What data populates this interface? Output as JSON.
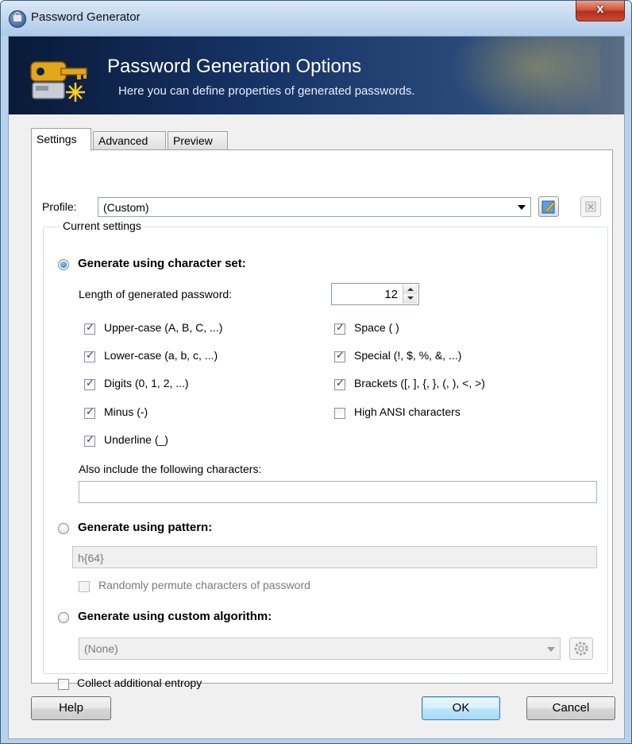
{
  "window": {
    "title": "Password Generator",
    "close_label": "x"
  },
  "banner": {
    "title": "Password Generation Options",
    "subtitle": "Here you can define properties of generated passwords."
  },
  "tabs": [
    {
      "label": "Settings",
      "active": true
    },
    {
      "label": "Advanced",
      "active": false
    },
    {
      "label": "Preview",
      "active": false
    }
  ],
  "profile": {
    "label": "Profile:",
    "value": "(Custom)"
  },
  "group": {
    "legend": "Current settings"
  },
  "charset": {
    "radio_label": "Generate using character set:",
    "selected": true,
    "length_label": "Length of generated password:",
    "length_value": "12",
    "options_left": [
      {
        "label": "Upper-case (A, B, C, ...)",
        "checked": true
      },
      {
        "label": "Lower-case (a, b, c, ...)",
        "checked": true
      },
      {
        "label": "Digits (0, 1, 2, ...)",
        "checked": true
      },
      {
        "label": "Minus (-)",
        "checked": true
      },
      {
        "label": "Underline (_)",
        "checked": true
      }
    ],
    "options_right": [
      {
        "label": "Space ( )",
        "checked": true
      },
      {
        "label": "Special (!, $, %, &, ...)",
        "checked": true
      },
      {
        "label": "Brackets ([, ], {, }, (, ), <, >)",
        "checked": true
      },
      {
        "label": "High ANSI characters",
        "checked": false
      }
    ],
    "also_include_label": "Also include the following characters:",
    "also_include_value": ""
  },
  "pattern": {
    "radio_label": "Generate using pattern:",
    "selected": false,
    "value": "h{64}",
    "permute_label": "Randomly permute characters of password",
    "permute_checked": false
  },
  "custom": {
    "radio_label": "Generate using custom algorithm:",
    "selected": false,
    "value": "(None)"
  },
  "entropy": {
    "label": "Collect additional entropy",
    "checked": false
  },
  "buttons": {
    "help": "Help",
    "ok": "OK",
    "cancel": "Cancel"
  }
}
